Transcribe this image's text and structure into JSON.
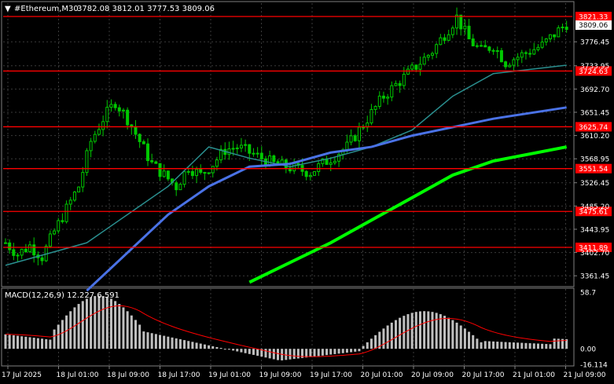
{
  "header": {
    "arrow": "▼",
    "symbol": "#Ethereum,M30",
    "ohlc": "3782.08 3812.01 3777.53 3809.06"
  },
  "colors": {
    "background": "#000000",
    "grid": "#3a3a3a",
    "candle": "#00c800",
    "level": "#ff0000",
    "ma_fast": "#2a8f8f",
    "ma_mid": "#4a72e6",
    "ma_slow": "#00ff00",
    "macd_hist": "#c0c0c0",
    "macd_signal": "#ff0000",
    "axis_text": "#ffffff"
  },
  "price_axis": {
    "ticks": [
      "3776.45",
      "3733.95",
      "3692.70",
      "3651.45",
      "3610.20",
      "3568.95",
      "3526.45",
      "3485.20",
      "3443.95",
      "3402.70",
      "3361.45"
    ],
    "current_price": "3809.06"
  },
  "levels": [
    {
      "label": "3821.33",
      "value": 3821.33
    },
    {
      "label": "3724.63",
      "value": 3724.63
    },
    {
      "label": "3625.74",
      "value": 3625.74
    },
    {
      "label": "3551.54",
      "value": 3551.54
    },
    {
      "label": "3475.61",
      "value": 3475.61
    },
    {
      "label": "3411.89",
      "value": 3411.89
    }
  ],
  "macd": {
    "label": "MACD(12,26,9) 12.227 6.591",
    "ticks": [
      "58.7",
      "0.00",
      "-16.114"
    ]
  },
  "time_axis": [
    "17 Jul 2025",
    "18 Jul 01:00",
    "18 Jul 09:00",
    "18 Jul 17:00",
    "19 Jul 01:00",
    "19 Jul 09:00",
    "19 Jul 17:00",
    "20 Jul 01:00",
    "20 Jul 09:00",
    "20 Jul 17:00",
    "21 Jul 01:00",
    "21 Jul 09:00"
  ],
  "chart_data": {
    "type": "candlestick",
    "price_range": [
      3345,
      3845
    ],
    "close_path": [
      [
        0,
        3420
      ],
      [
        3,
        3400
      ],
      [
        6,
        3415
      ],
      [
        9,
        3395
      ],
      [
        12,
        3440
      ],
      [
        15,
        3480
      ],
      [
        18,
        3520
      ],
      [
        21,
        3600
      ],
      [
        24,
        3640
      ],
      [
        27,
        3670
      ],
      [
        30,
        3640
      ],
      [
        33,
        3600
      ],
      [
        36,
        3560
      ],
      [
        39,
        3540
      ],
      [
        42,
        3520
      ],
      [
        45,
        3555
      ],
      [
        48,
        3540
      ],
      [
        51,
        3560
      ],
      [
        54,
        3585
      ],
      [
        57,
        3590
      ],
      [
        60,
        3580
      ],
      [
        63,
        3570
      ],
      [
        66,
        3560
      ],
      [
        69,
        3555
      ],
      [
        72,
        3550
      ],
      [
        75,
        3545
      ],
      [
        78,
        3560
      ],
      [
        81,
        3575
      ],
      [
        84,
        3590
      ],
      [
        87,
        3620
      ],
      [
        90,
        3650
      ],
      [
        93,
        3680
      ],
      [
        96,
        3700
      ],
      [
        99,
        3720
      ],
      [
        102,
        3740
      ],
      [
        105,
        3760
      ],
      [
        108,
        3790
      ],
      [
        111,
        3820
      ],
      [
        114,
        3780
      ],
      [
        117,
        3760
      ],
      [
        120,
        3770
      ],
      [
        123,
        3740
      ],
      [
        126,
        3750
      ],
      [
        129,
        3760
      ],
      [
        132,
        3770
      ],
      [
        135,
        3790
      ],
      [
        138,
        3809
      ]
    ],
    "ma_fast": [
      [
        0,
        3380
      ],
      [
        20,
        3420
      ],
      [
        40,
        3520
      ],
      [
        50,
        3590
      ],
      [
        60,
        3570
      ],
      [
        70,
        3555
      ],
      [
        80,
        3570
      ],
      [
        90,
        3590
      ],
      [
        100,
        3620
      ],
      [
        110,
        3680
      ],
      [
        120,
        3720
      ],
      [
        138,
        3735
      ]
    ],
    "ma_mid": [
      [
        20,
        3335
      ],
      [
        40,
        3470
      ],
      [
        50,
        3520
      ],
      [
        60,
        3555
      ],
      [
        70,
        3560
      ],
      [
        80,
        3580
      ],
      [
        90,
        3590
      ],
      [
        100,
        3610
      ],
      [
        110,
        3625
      ],
      [
        120,
        3640
      ],
      [
        138,
        3660
      ]
    ],
    "ma_slow": [
      [
        60,
        3350
      ],
      [
        80,
        3420
      ],
      [
        90,
        3460
      ],
      [
        100,
        3500
      ],
      [
        110,
        3540
      ],
      [
        120,
        3565
      ],
      [
        138,
        3590
      ]
    ],
    "levels": [
      3821.33,
      3724.63,
      3625.74,
      3551.54,
      3475.61,
      3411.89
    ],
    "macd_range": [
      -16.114,
      58.7
    ]
  }
}
